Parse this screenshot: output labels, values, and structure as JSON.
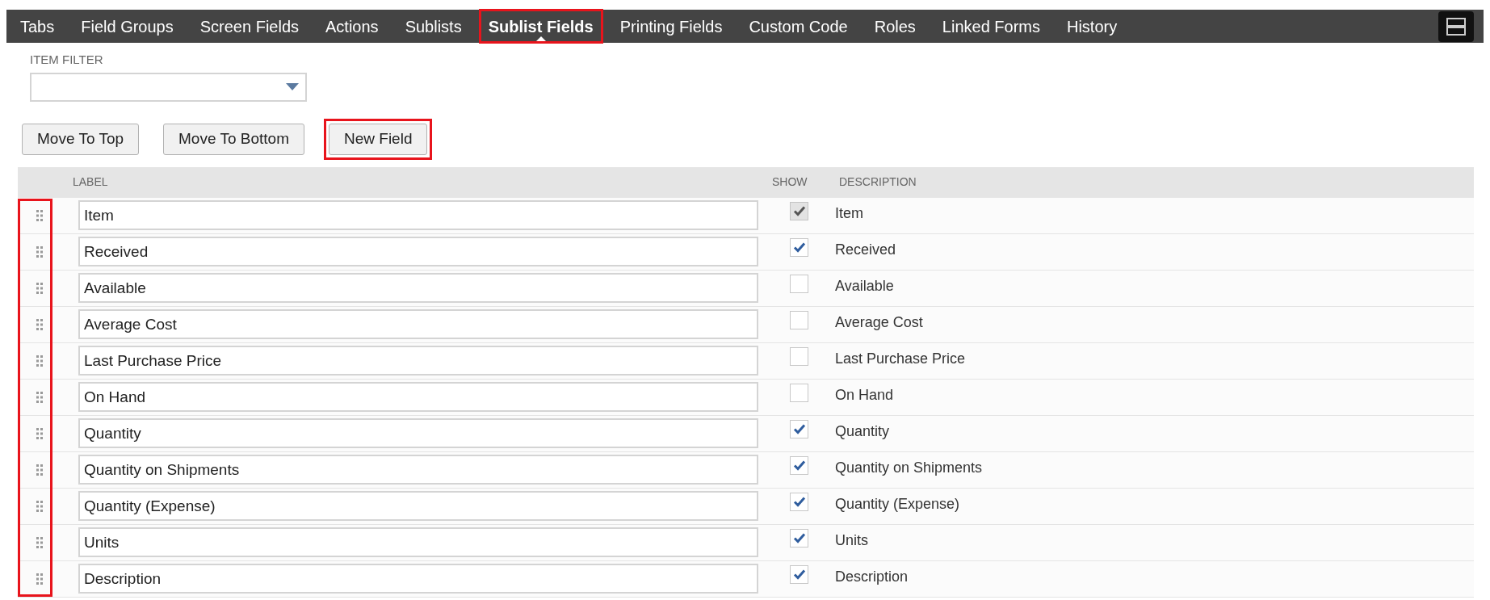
{
  "tabs": [
    {
      "label": "Tabs",
      "selected": false,
      "highlighted": false
    },
    {
      "label": "Field Groups",
      "selected": false,
      "highlighted": false
    },
    {
      "label": "Screen Fields",
      "selected": false,
      "highlighted": false
    },
    {
      "label": "Actions",
      "selected": false,
      "highlighted": false
    },
    {
      "label": "Sublists",
      "selected": false,
      "highlighted": false
    },
    {
      "label": "Sublist Fields",
      "selected": true,
      "highlighted": true
    },
    {
      "label": "Printing Fields",
      "selected": false,
      "highlighted": false
    },
    {
      "label": "Custom Code",
      "selected": false,
      "highlighted": false
    },
    {
      "label": "Roles",
      "selected": false,
      "highlighted": false
    },
    {
      "label": "Linked Forms",
      "selected": false,
      "highlighted": false
    },
    {
      "label": "History",
      "selected": false,
      "highlighted": false
    }
  ],
  "item_filter": {
    "label": "ITEM FILTER"
  },
  "buttons": [
    {
      "label": "Move To Top",
      "highlighted": false
    },
    {
      "label": "Move To Bottom",
      "highlighted": false
    },
    {
      "label": "New Field",
      "highlighted": true
    }
  ],
  "table": {
    "columns": [
      "LABEL",
      "SHOW",
      "DESCRIPTION"
    ],
    "handles_highlighted": true,
    "rows": [
      {
        "label": "Item",
        "show": true,
        "disabled": true,
        "description": "Item"
      },
      {
        "label": "Received",
        "show": true,
        "disabled": false,
        "description": "Received"
      },
      {
        "label": "Available",
        "show": false,
        "disabled": false,
        "description": "Available"
      },
      {
        "label": "Average Cost",
        "show": false,
        "disabled": false,
        "description": "Average Cost"
      },
      {
        "label": "Last Purchase Price",
        "show": false,
        "disabled": false,
        "description": "Last Purchase Price"
      },
      {
        "label": "On Hand",
        "show": false,
        "disabled": false,
        "description": "On Hand"
      },
      {
        "label": "Quantity",
        "show": true,
        "disabled": false,
        "description": "Quantity"
      },
      {
        "label": "Quantity on Shipments",
        "show": true,
        "disabled": false,
        "description": "Quantity on Shipments"
      },
      {
        "label": "Quantity (Expense)",
        "show": true,
        "disabled": false,
        "description": "Quantity (Expense)"
      },
      {
        "label": "Units",
        "show": true,
        "disabled": false,
        "description": "Units"
      },
      {
        "label": "Description",
        "show": true,
        "disabled": false,
        "description": "Description"
      }
    ]
  }
}
